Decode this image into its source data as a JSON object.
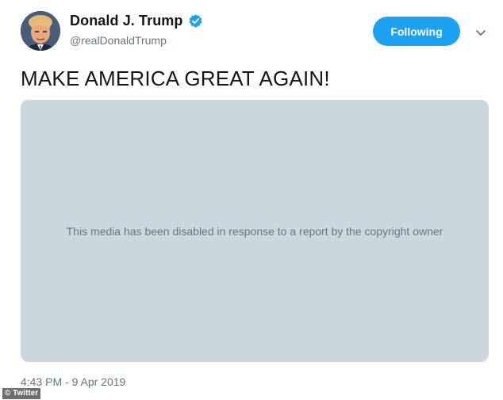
{
  "user": {
    "display_name": "Donald J. Trump",
    "handle": "@realDonaldTrump",
    "verified": true,
    "avatar_icon": "profile-photo"
  },
  "follow_button": {
    "label": "Following",
    "color": "#1da1f2"
  },
  "menu": {
    "icon": "chevron-down-icon"
  },
  "tweet": {
    "text": "MAKE AMERICA GREAT AGAIN!",
    "media_message": "This media has been disabled in response to a report by the copyright owner",
    "timestamp": "4:43 PM - 9 Apr 2019"
  },
  "credit": {
    "label": "© Twitter"
  },
  "colors": {
    "accent": "#1da1f2",
    "media_background": "#ccd6dd",
    "secondary_text": "#657786",
    "primary_text": "#14171a"
  }
}
